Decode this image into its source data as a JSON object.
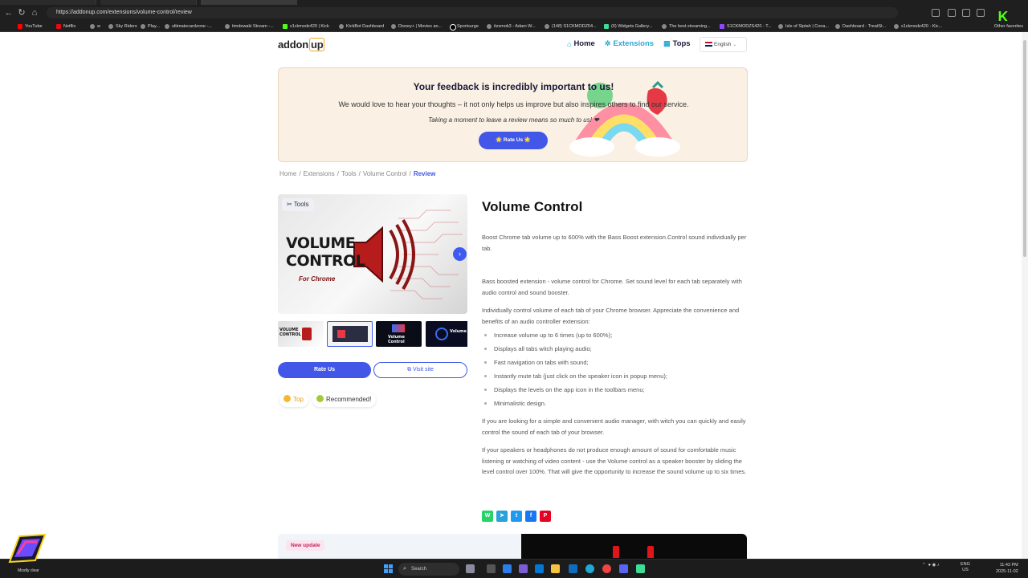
{
  "browser": {
    "url": "https://addonup.com/extensions/volume-control/review",
    "bookmarks": [
      {
        "label": "YouTube",
        "cls": "yt"
      },
      {
        "label": "Netflix",
        "cls": "nf"
      },
      {
        "label": "w",
        "cls": ""
      },
      {
        "label": "Sky Riders",
        "cls": ""
      },
      {
        "label": "Play...",
        "cls": ""
      },
      {
        "label": "ultimatecardzone -...",
        "cls": ""
      },
      {
        "label": "timdewaki Stream -...",
        "cls": ""
      },
      {
        "label": "s1ckmodz420 | Kick",
        "cls": "kb"
      },
      {
        "label": "KickBot Dashboard",
        "cls": ""
      },
      {
        "label": "Disney+ | Movies an...",
        "cls": ""
      },
      {
        "label": "Sportsurge",
        "cls": "sp"
      },
      {
        "label": "itzsmok3 - Adam W...",
        "cls": ""
      },
      {
        "label": "(148) S1CKMODZ54...",
        "cls": ""
      },
      {
        "label": "(6) Widgets Gallery...",
        "cls": "wg"
      },
      {
        "label": "The best streaming...",
        "cls": ""
      },
      {
        "label": "S1CKMODZS420 - T...",
        "cls": "tw"
      },
      {
        "label": "Isle of Siptah | Cona...",
        "cls": ""
      },
      {
        "label": "Dashboard - TreatSt...",
        "cls": ""
      },
      {
        "label": "s1ckmodz420 - Kic...",
        "cls": ""
      }
    ],
    "other_favorites": "Other favorites"
  },
  "site": {
    "logo_text": "addon",
    "logo_up": "up",
    "nav": {
      "home": "Home",
      "extensions": "Extensions",
      "tops": "Tops"
    },
    "language": "English"
  },
  "banner": {
    "title": "Your feedback is incredibly important to us!",
    "subtitle": "We would love to hear your thoughts – it not only helps us improve but also inspires others to find our service.",
    "note": "Taking a moment to leave a review means so much to us! ❤",
    "button": "🌟 Rate Us 🌟"
  },
  "breadcrumb": {
    "home": "Home",
    "extensions": "Extensions",
    "tools": "Tools",
    "item": "Volume Control",
    "current": "Review"
  },
  "gallery": {
    "category_badge": "Tools",
    "image_title_line1": "VOLUME",
    "image_title_line2": "CONTROL",
    "image_subtitle": "For Chrome"
  },
  "actions": {
    "rate": "Rate Us",
    "visit": "Visit site"
  },
  "badges": {
    "top": "Top",
    "recommended": "Recommended!"
  },
  "extension": {
    "title": "Volume Control",
    "summary": "Boost Chrome tab volume up to 600% with the Bass Boost extension.Control sound individually per tab.",
    "para1": "Bass boosted extension - volume control for Chrome. Set sound level for each tab separately with audio control and sound booster.",
    "para2": "Individually control volume of each tab of your Chrome browser. Appreciate the convenience and benefits of an audio controller extension:",
    "features": [
      "Increase volume up to 6 times (up to 600%);",
      "Displays all tabs witch playing audio;",
      "Fast navigation on tabs with sound;",
      "Instantly mute tab (just click on the speaker icon in popup menu);",
      "Displays the levels on the app icon in the toolbars menu;",
      "Minimalistic design."
    ],
    "para3": "If you are looking for a simple and convenient audio manager, with witch you can quickly and easily control the sound of each tab of your browser.",
    "para4": "If your speakers or headphones do not produce enough amount of sound for comfortable music listening or watching of video content - use the Volume control as a speaker booster by sliding the level control over 100%. That will give the opportunity to increase the sound volume up to six times."
  },
  "bottom": {
    "new_update": "New update"
  },
  "taskbar": {
    "weather": "Mostly clear",
    "search": "Search",
    "lang_line1": "ENG",
    "lang_line2": "US",
    "time": "11:43 PM",
    "date": "2025-11-02"
  }
}
